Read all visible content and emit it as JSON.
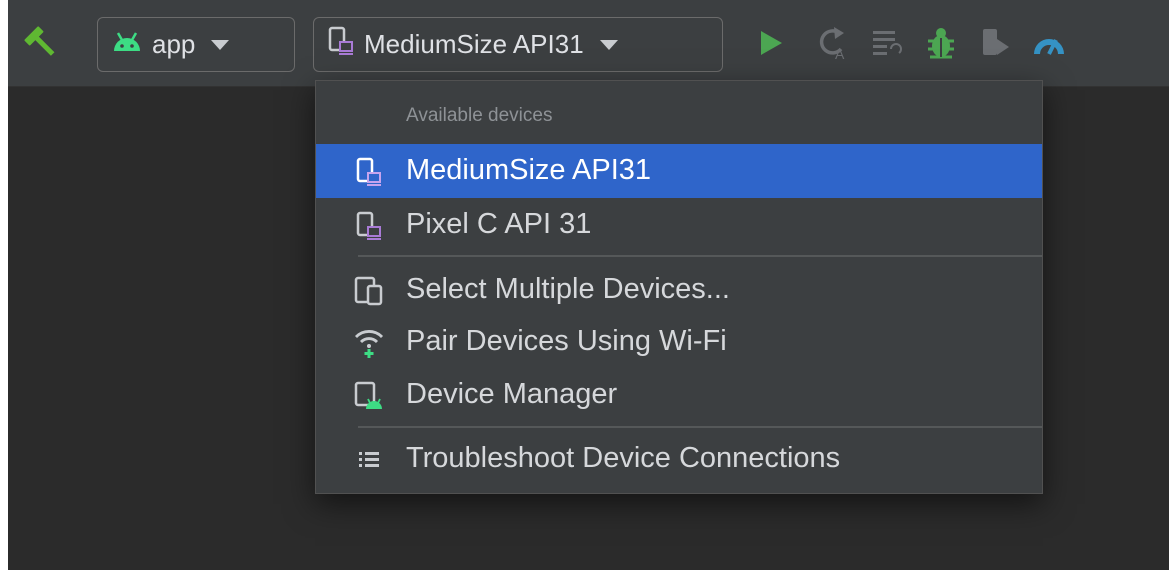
{
  "toolbar": {
    "module_selector": {
      "label": "app",
      "icon": "android-icon"
    },
    "device_selector": {
      "label": "MediumSize API31",
      "icon": "device-icon"
    },
    "actions": [
      {
        "name": "make-project",
        "icon": "hammer-icon",
        "color": "#5fb832"
      },
      {
        "name": "run",
        "icon": "run-icon",
        "color": "#4ca652"
      },
      {
        "name": "apply-changes",
        "icon": "apply-changes-icon"
      },
      {
        "name": "apply-code-changes",
        "icon": "apply-code-changes-icon"
      },
      {
        "name": "debug",
        "icon": "bug-icon",
        "color": "#4ca652"
      },
      {
        "name": "attach-debugger",
        "icon": "attach-debugger-icon"
      },
      {
        "name": "profile",
        "icon": "profiler-icon",
        "color": "#3592c4"
      }
    ]
  },
  "menu": {
    "header": "Available devices",
    "devices": [
      {
        "label": "MediumSize API31",
        "icon": "device-icon",
        "selected": true
      },
      {
        "label": "Pixel C API 31",
        "icon": "device-icon",
        "selected": false
      }
    ],
    "actions": [
      {
        "label": "Select Multiple Devices...",
        "icon": "multiple-devices-icon"
      },
      {
        "label": "Pair Devices Using Wi-Fi",
        "icon": "wifi-pair-icon"
      },
      {
        "label": "Device Manager",
        "icon": "device-manager-icon"
      }
    ],
    "footer": [
      {
        "label": "Troubleshoot Device Connections",
        "icon": "list-icon"
      }
    ]
  },
  "colors": {
    "accent_selection": "#2f65ca",
    "android_green": "#3ddc84",
    "device_purple": "#a97bd6"
  }
}
